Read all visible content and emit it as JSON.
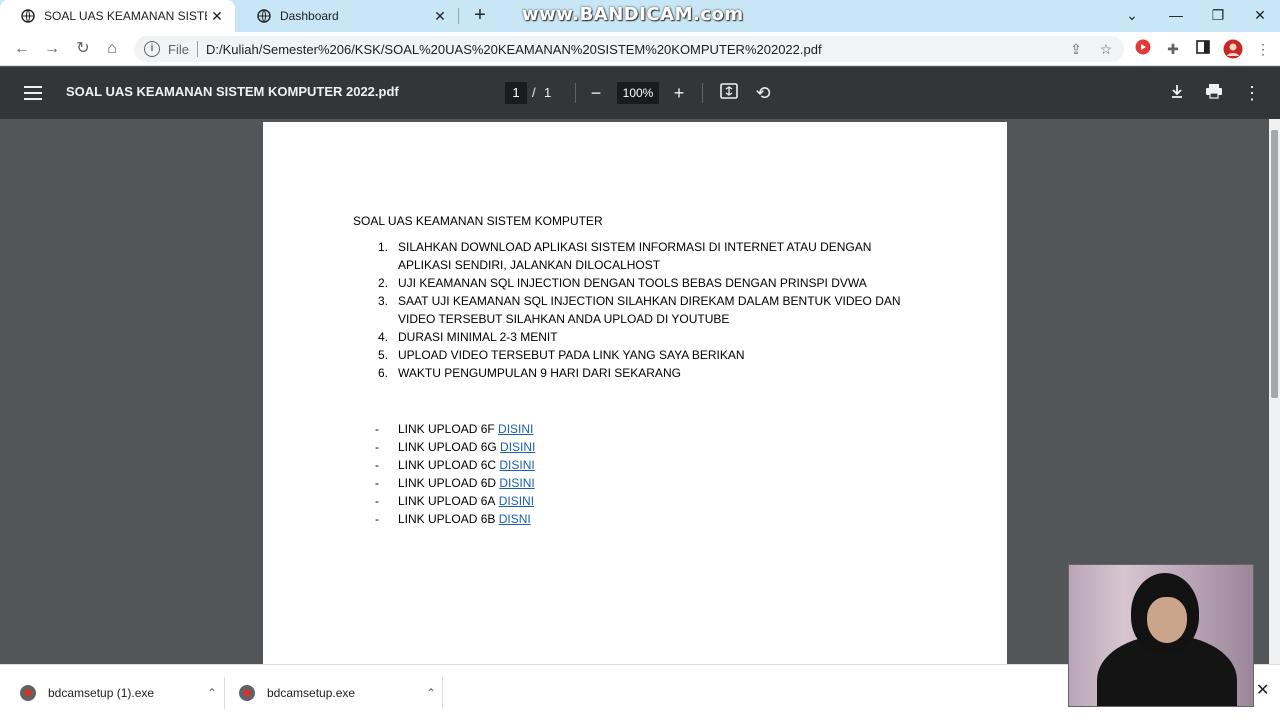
{
  "browser": {
    "tabs": [
      {
        "title": "SOAL UAS KEAMANAN SISTEM K",
        "active": true
      },
      {
        "title": "Dashboard",
        "active": false
      }
    ],
    "watermark": "www.BANDICAM.com",
    "address": {
      "security_label": "File",
      "url": "D:/Kuliah/Semester%206/KSK/SOAL%20UAS%20KEAMANAN%20SISTEM%20KOMPUTER%202022.pdf"
    }
  },
  "pdf_toolbar": {
    "title": "SOAL UAS KEAMANAN SISTEM KOMPUTER 2022.pdf",
    "current_page": "1",
    "separator": "/",
    "total_pages": "1",
    "zoom": "100%"
  },
  "document": {
    "heading": "SOAL UAS KEAMANAN SISTEM KOMPUTER",
    "items": [
      {
        "num": "1.",
        "text": "SILAHKAN DOWNLOAD APLIKASI SISTEM INFORMASI DI INTERNET ATAU DENGAN APLIKASI SENDIRI, JALANKAN DILOCALHOST"
      },
      {
        "num": "2.",
        "text": "UJI KEAMANAN SQL INJECTION DENGAN TOOLS BEBAS DENGAN PRINSPI DVWA"
      },
      {
        "num": "3.",
        "text": "SAAT UJI KEAMANAN SQL INJECTION SILAHKAN DIREKAM DALAM BENTUK VIDEO DAN VIDEO TERSEBUT SILAHKAN ANDA UPLOAD DI YOUTUBE"
      },
      {
        "num": "4.",
        "text": "DURASI MINIMAL 2-3 MENIT"
      },
      {
        "num": "5.",
        "text": "UPLOAD VIDEO TERSEBUT PADA LINK YANG SAYA BERIKAN"
      },
      {
        "num": "6.",
        "text": "WAKTU PENGUMPULAN 9 HARI DARI SEKARANG"
      }
    ],
    "links": [
      {
        "dash": "-",
        "label": "LINK UPLOAD 6F",
        "link": "DISINI"
      },
      {
        "dash": "-",
        "label": "LINK UPLOAD 6G",
        "link": "DISINI"
      },
      {
        "dash": "-",
        "label": "LINK UPLOAD 6C",
        "link": "DISINI"
      },
      {
        "dash": "-",
        "label": "LINK UPLOAD 6D",
        "link": "DISINI"
      },
      {
        "dash": "-",
        "label": "LINK UPLOAD 6A",
        "link": "DISINI"
      },
      {
        "dash": "-",
        "label": "LINK UPLOAD 6B",
        "link": "DISNI"
      }
    ]
  },
  "downloads": [
    {
      "name": "bdcamsetup (1).exe"
    },
    {
      "name": "bdcamsetup.exe"
    }
  ],
  "colors": {
    "tabstrip": "#c8e6f5",
    "pdf_toolbar": "#323639",
    "viewer_bg": "#525659",
    "link": "#1a5fb4"
  }
}
